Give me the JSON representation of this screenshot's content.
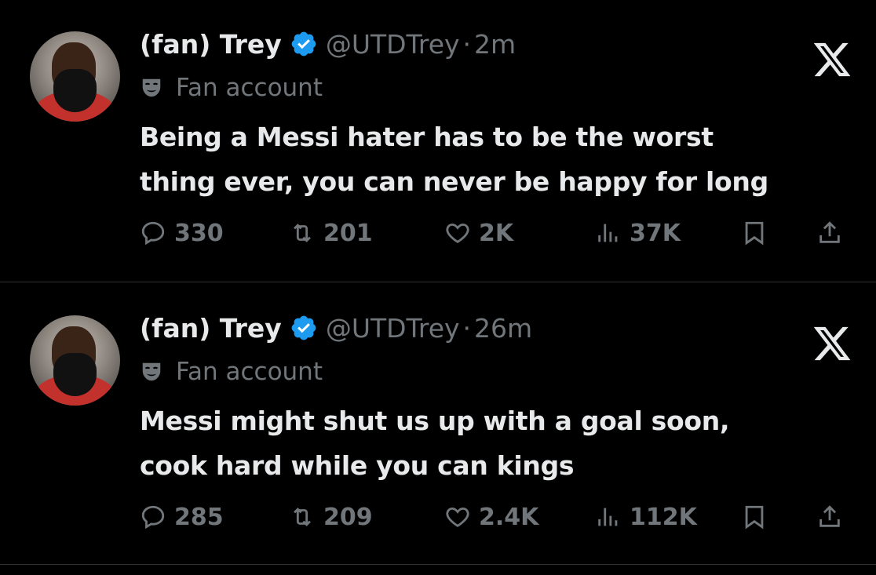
{
  "tweets": [
    {
      "display_name": "(fan) Trey",
      "handle": "@UTDTrey",
      "separator": "·",
      "time": "2m",
      "label": "Fan account",
      "text_lines": [
        "Being a Messi hater has to be the worst",
        "thing ever, you can never be happy for long"
      ],
      "stats": {
        "replies": "330",
        "retweets": "201",
        "likes": "2K",
        "views": "37K"
      }
    },
    {
      "display_name": "(fan) Trey",
      "handle": "@UTDTrey",
      "separator": "·",
      "time": "26m",
      "label": "Fan account",
      "text_lines": [
        "Messi might shut us up with a goal soon,",
        "cook hard while you can kings"
      ],
      "stats": {
        "replies": "285",
        "retweets": "209",
        "likes": "2.4K",
        "views": "112K"
      }
    }
  ],
  "icons": {
    "verified": "verified-badge-icon",
    "label": "theater-mask-icon",
    "logo": "x-logo-icon",
    "reply": "reply-icon",
    "retweet": "retweet-icon",
    "like": "heart-icon",
    "views": "views-icon",
    "bookmark": "bookmark-icon",
    "share": "share-icon"
  },
  "colors": {
    "background": "#000000",
    "text_primary": "#e7e9ea",
    "text_secondary": "#71767b",
    "verified_blue": "#1d9bf0",
    "divider": "#2f3336"
  }
}
